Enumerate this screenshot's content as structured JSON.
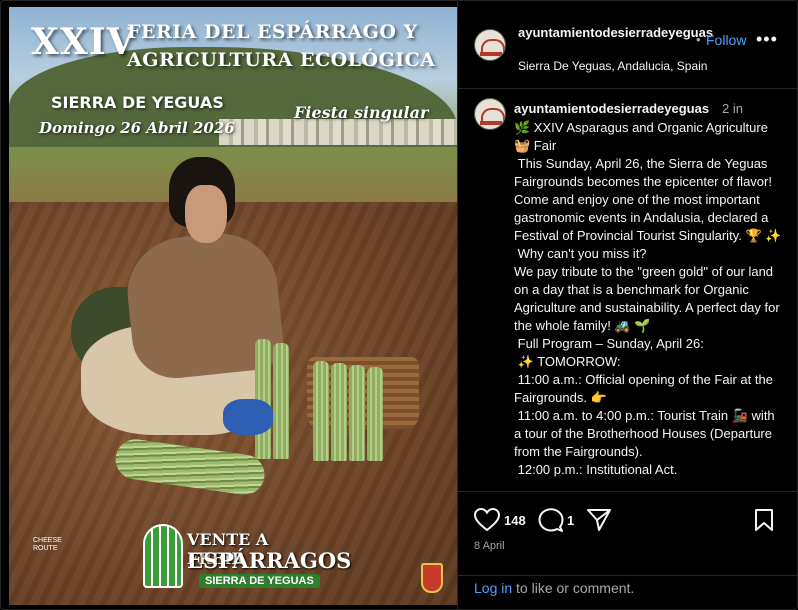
{
  "poster": {
    "number": "XXIV",
    "title_line1": "FERIA DEL ESPÁRRAGO Y",
    "title_line2": "AGRICULTURA ECOLÓGICA",
    "place": "SIERRA DE YEGUAS",
    "date": "Domingo 26 Abril 2026",
    "tagline": "Fiesta singular",
    "logo_line1": "VENTE A FREIR",
    "logo_line2": "ESPÁRRAGOS",
    "logo_line3": "SIERRA DE YEGUAS",
    "sponsor_text": "CHEESE ROUTE"
  },
  "header": {
    "username": "ayuntamientodesierradeyeguas",
    "dot": "•",
    "follow_label": "Follow",
    "more_label": "•••",
    "location": "Sierra De Yeguas, Andalucia, Spain"
  },
  "caption": {
    "username": "ayuntamientodesierradeyeguas",
    "time": "2 in",
    "text": "🌿 XXIV Asparagus and Organic Agriculture 🧺 Fair\n This Sunday, April 26, the Sierra de Yeguas Fairgrounds becomes the epicenter of flavor! Come and enjoy one of the most important gastronomic events in Andalusia, declared a Festival of Provincial Tourist Singularity. 🏆 ✨\n Why can't you miss it?\nWe pay tribute to the \"green gold\" of our land on a day that is a benchmark for Organic Agriculture and sustainability. A perfect day for the whole family! 🚜 🌱\n Full Program – Sunday, April 26:\n ✨ TOMORROW:\n 11:00 a.m.: Official opening of the Fair at the Fairgrounds. 👉\n 11:00 a.m. to 4:00 p.m.: Tourist Train 🚂 with a tour of the Brotherhood Houses (Departure from the Fairgrounds).\n 12:00 p.m.: Institutional Act."
  },
  "actions": {
    "likes": "148",
    "comments": "1",
    "date": "8 April"
  },
  "footer": {
    "login_label": "Log in",
    "rest_label": " to like or comment."
  },
  "colors": {
    "link": "#4da3ff",
    "background": "#000000",
    "secondary_text": "#a8a8a8"
  }
}
